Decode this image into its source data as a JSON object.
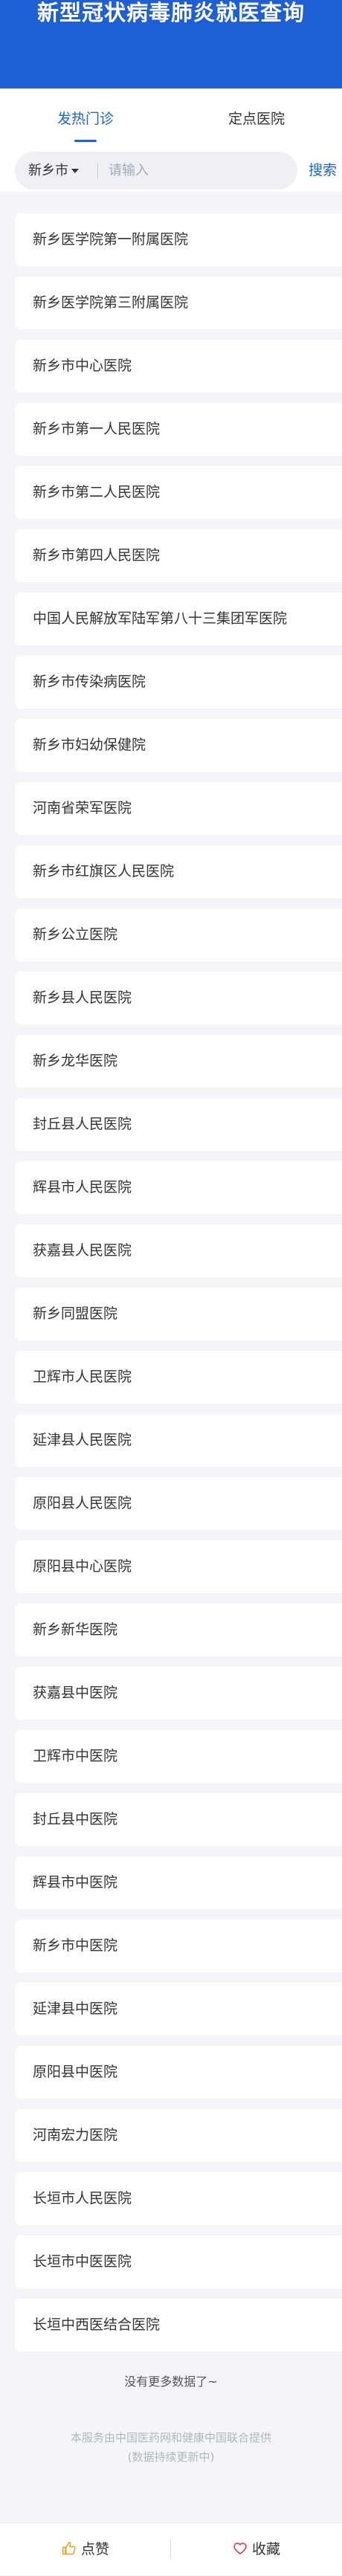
{
  "header": {
    "title": "新型冠状病毒肺炎就医查询"
  },
  "tabs": [
    {
      "label": "发热门诊",
      "active": true
    },
    {
      "label": "定点医院",
      "active": false
    }
  ],
  "search": {
    "city": "新乡市",
    "placeholder": "请输入",
    "value": "",
    "button_label": "搜索"
  },
  "hospitals": [
    "新乡医学院第一附属医院",
    "新乡医学院第三附属医院",
    "新乡市中心医院",
    "新乡市第一人民医院",
    "新乡市第二人民医院",
    "新乡市第四人民医院",
    "中国人民解放军陆军第八十三集团军医院",
    "新乡市传染病医院",
    "新乡市妇幼保健院",
    "河南省荣军医院",
    "新乡市红旗区人民医院",
    "新乡公立医院",
    "新乡县人民医院",
    "新乡龙华医院",
    "封丘县人民医院",
    "辉县市人民医院",
    "获嘉县人民医院",
    "新乡同盟医院",
    "卫辉市人民医院",
    "延津县人民医院",
    "原阳县人民医院",
    "原阳县中心医院",
    "新乡新华医院",
    "获嘉县中医院",
    "卫辉市中医院",
    "封丘县中医院",
    "辉县市中医院",
    "新乡市中医院",
    "延津县中医院",
    "原阳县中医院",
    "河南宏力医院",
    "长垣市人民医院",
    "长垣市中医医院",
    "长垣中西医结合医院"
  ],
  "footer": {
    "no_more": "没有更多数据了~",
    "source_line1": "本服务由中国医药网和健康中国联合提供",
    "source_line2": "(数据持续更新中)"
  },
  "bottom_bar": {
    "like_label": "点赞",
    "favorite_label": "收藏",
    "accent_color": "#f0a020",
    "heart_color": "#e0334a"
  },
  "colors": {
    "header_bg": "#1f5fd6",
    "accent": "#1f64d6",
    "page_bg": "#f3f5f9"
  }
}
